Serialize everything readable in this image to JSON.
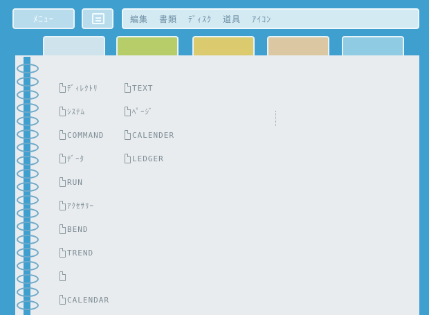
{
  "toolbar": {
    "menu_label": "ﾒﾆｭｰ",
    "menus": [
      "編集",
      "書類",
      "ﾃﾞｨｽｸ",
      "道具",
      "ｱｲｺﾝ"
    ]
  },
  "tabs": [
    {
      "color": "#cfe3ec"
    },
    {
      "color": "#b7cd6a"
    },
    {
      "color": "#dccb6e"
    },
    {
      "color": "#dcc7a3"
    },
    {
      "color": "#8fcbe3"
    }
  ],
  "files_column_1": [
    "ﾃﾞｨﾚｸﾄﾘ",
    "ｼｽﾃﾑ",
    "COMMAND",
    "ﾃﾞｰﾀ",
    "RUN",
    "ｱｸｾｻﾘｰ",
    "BEND",
    "TREND",
    "",
    "CALENDAR"
  ],
  "files_column_2": [
    "TEXT",
    "ﾍﾟｰｼﾞ",
    "CALENDER",
    "LEDGER"
  ]
}
